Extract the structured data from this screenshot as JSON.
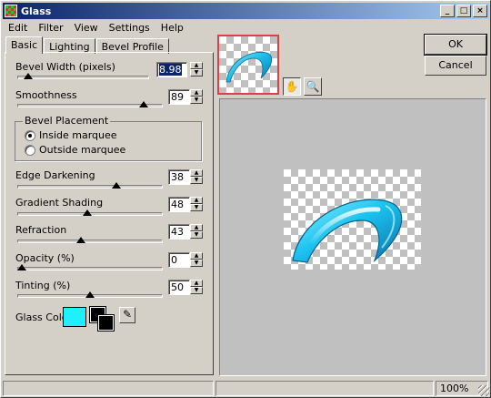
{
  "window": {
    "title": "Glass"
  },
  "menu": [
    "Edit",
    "Filter",
    "View",
    "Settings",
    "Help"
  ],
  "tabs": [
    "Basic",
    "Lighting",
    "Bevel Profile"
  ],
  "controls": {
    "bevel_width": {
      "label": "Bevel Width (pixels)",
      "value": "8.98",
      "level": 0.05
    },
    "smoothness": {
      "label": "Smoothness",
      "value": "89",
      "level": 0.89
    },
    "edge_darkening": {
      "label": "Edge Darkening",
      "value": "38",
      "level": 0.69
    },
    "gradient_shading": {
      "label": "Gradient Shading",
      "value": "48",
      "level": 0.48
    },
    "refraction": {
      "label": "Refraction",
      "value": "43",
      "level": 0.43
    },
    "opacity": {
      "label": "Opacity (%)",
      "value": "0",
      "level": 0.0
    },
    "tinting": {
      "label": "Tinting (%)",
      "value": "50",
      "level": 0.5
    }
  },
  "bevel_placement": {
    "title": "Bevel Placement",
    "options": [
      "Inside marquee",
      "Outside marquee"
    ],
    "selected": "Inside marquee"
  },
  "glass_color": {
    "label": "Glass Color",
    "color": "#1ff0ff"
  },
  "buttons": {
    "ok": "OK",
    "cancel": "Cancel"
  },
  "status": {
    "zoom": "100%"
  },
  "icons": {
    "pan": "hand-icon",
    "zoom": "magnifier-icon",
    "dropper": "eyedropper-icon"
  }
}
